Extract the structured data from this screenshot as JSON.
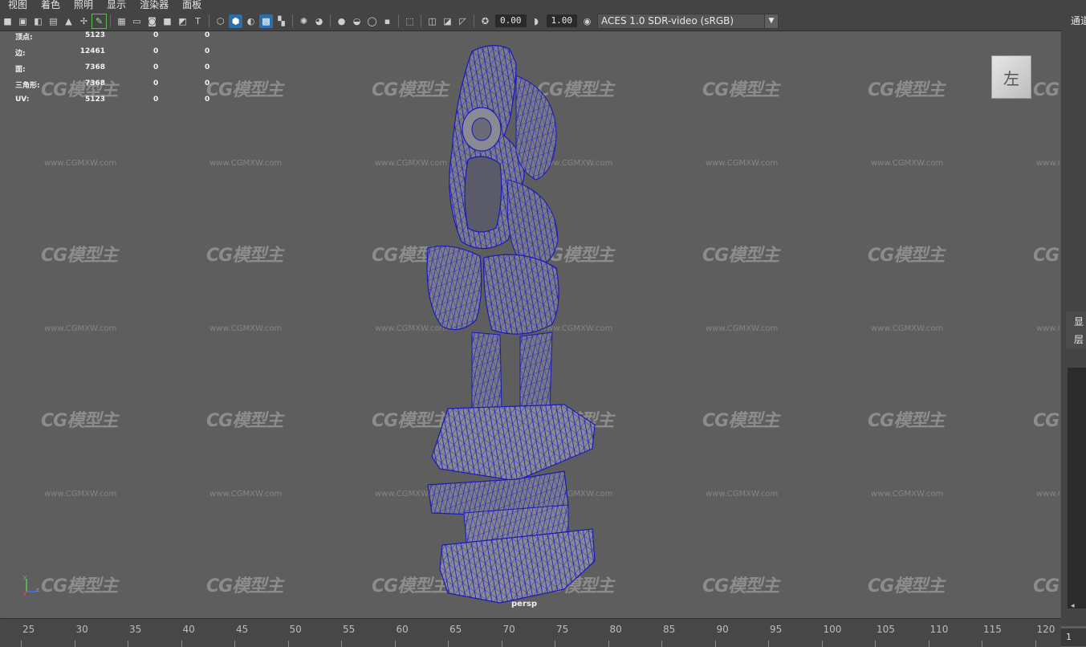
{
  "menu": [
    "视图",
    "着色",
    "照明",
    "显示",
    "渲染器",
    "面板"
  ],
  "toolbar": {
    "exposure_value": "0.00",
    "gamma_value": "1.00",
    "colorspace": "ACES 1.0 SDR-video (sRGB)",
    "icons": [
      "camera-icon",
      "camera-attributes-icon",
      "bookmark-icon",
      "image-plane-icon",
      "grid-icon",
      "film-gate-icon",
      "resolution-gate-icon",
      "gate-mask-icon",
      "field-chart-icon",
      "safe-action-icon",
      "safe-title-icon",
      "wireframe-icon",
      "smooth-shade-icon",
      "use-default-material-icon",
      "wireframe-on-shaded-icon",
      "xray-icon",
      "lights-icon",
      "shadows-icon",
      "ambient-occlusion-icon",
      "motion-blur-icon",
      "isolate-select-icon",
      "xray-joints-icon",
      "backface-icon",
      "exposure-icon",
      "gamma-icon",
      "color-management-icon"
    ]
  },
  "hud": [
    {
      "label": "顶点:",
      "v1": "5123",
      "v2": "0",
      "v3": "0"
    },
    {
      "label": "边:",
      "v1": "12461",
      "v2": "0",
      "v3": "0"
    },
    {
      "label": "面:",
      "v1": "7368",
      "v2": "0",
      "v3": "0"
    },
    {
      "label": "三角形:",
      "v1": "7368",
      "v2": "0",
      "v3": "0"
    },
    {
      "label": "UV:",
      "v1": "5123",
      "v2": "0",
      "v3": "0"
    }
  ],
  "viewcube_label": "左",
  "camera_label": "persp",
  "watermark_text": "CG模型主",
  "watermark_url": "www.CGMXW.com",
  "axis": {
    "y": "y",
    "z": "z"
  },
  "right_panel": {
    "top_label": "通道",
    "tab1": "显",
    "tab2": "层",
    "scroll_glyph": "◂"
  },
  "timeline": {
    "ticks": [
      25,
      30,
      35,
      40,
      45,
      50,
      55,
      60,
      65,
      70,
      75,
      80,
      85,
      90,
      95,
      100,
      105,
      110,
      115,
      120
    ],
    "current_frame": "1"
  },
  "colors": {
    "wire": "#1a1ab8",
    "mesh": "#7a7a86",
    "viewport": "#5e5e5e",
    "ui": "#444444"
  }
}
